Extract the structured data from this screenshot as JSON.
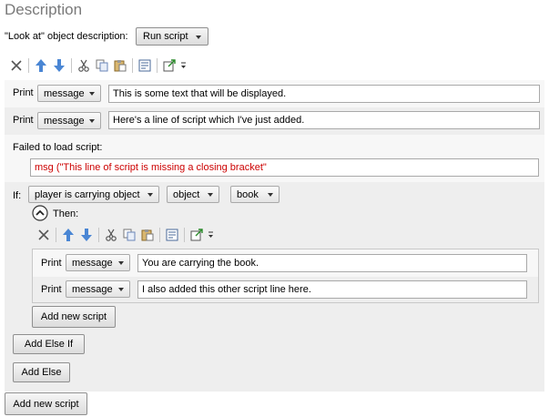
{
  "heading": "Description",
  "look_at": {
    "label": "\"Look at\" object description:",
    "mode": "Run script"
  },
  "script_lines": [
    {
      "cmd": "Print",
      "type": "message",
      "text": "This is some text that will be displayed."
    },
    {
      "cmd": "Print",
      "type": "message",
      "text": "Here's a line of script which I've just added."
    }
  ],
  "failed": {
    "label": "Failed to load script:",
    "code": "msg (\"This line of script is missing a closing bracket\""
  },
  "if_block": {
    "label": "If:",
    "condition": "player is carrying object",
    "param_type": "object",
    "param_value": "book",
    "then_label": "Then:",
    "lines": [
      {
        "cmd": "Print",
        "type": "message",
        "text": "You are carrying the book."
      },
      {
        "cmd": "Print",
        "type": "message",
        "text": "I also added this other script line here."
      }
    ],
    "add_new_script": "Add new script",
    "add_else_if": "Add Else If",
    "add_else": "Add Else"
  },
  "add_new_script": "Add new script",
  "colors": {
    "error": "#cc0000",
    "heading": "#7a7a7a",
    "arrow": "#4a86d4"
  }
}
